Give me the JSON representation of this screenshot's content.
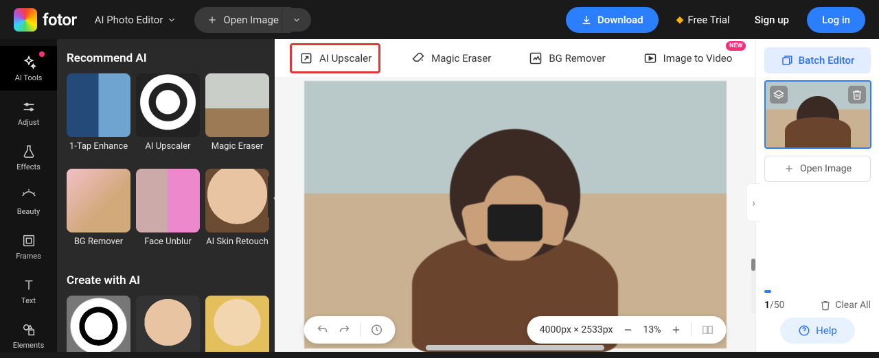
{
  "brand": {
    "name": "fotor"
  },
  "header": {
    "mode": "AI Photo Editor",
    "open_image": "Open Image",
    "download": "Download",
    "free_trial": "Free Trial",
    "sign_up": "Sign up",
    "log_in": "Log in"
  },
  "leftbar": {
    "items": [
      {
        "id": "ai-tools",
        "label": "AI Tools",
        "active": true,
        "badge": true
      },
      {
        "id": "adjust",
        "label": "Adjust"
      },
      {
        "id": "effects",
        "label": "Effects"
      },
      {
        "id": "beauty",
        "label": "Beauty"
      },
      {
        "id": "frames",
        "label": "Frames"
      },
      {
        "id": "text",
        "label": "Text"
      },
      {
        "id": "elements",
        "label": "Elements"
      }
    ]
  },
  "sidepanel": {
    "section1_title": "Recommend AI",
    "section1_items": [
      {
        "id": "1tap",
        "label": "1-Tap Enhance"
      },
      {
        "id": "upscale",
        "label": "AI Upscaler"
      },
      {
        "id": "eraser",
        "label": "Magic Eraser"
      },
      {
        "id": "bgremove",
        "label": "BG Remover"
      },
      {
        "id": "unblur",
        "label": "Face Unblur"
      },
      {
        "id": "retouch",
        "label": "AI Skin Retouch"
      }
    ],
    "section2_title": "Create with AI"
  },
  "tool_tabs": [
    {
      "id": "ai-upscaler",
      "label": "AI Upscaler",
      "active": true
    },
    {
      "id": "magic-eraser",
      "label": "Magic Eraser"
    },
    {
      "id": "bg-remover",
      "label": "BG Remover"
    },
    {
      "id": "image-to-video",
      "label": "Image to Video",
      "badge": "NEW"
    }
  ],
  "canvas": {
    "dimensions_label": "4000px × 2533px",
    "zoom_label": "13%"
  },
  "rightpanel": {
    "batch_editor": "Batch Editor",
    "open_image": "Open Image",
    "count_current": "1",
    "count_sep_total": "/50",
    "clear_all": "Clear All",
    "help": "Help"
  }
}
